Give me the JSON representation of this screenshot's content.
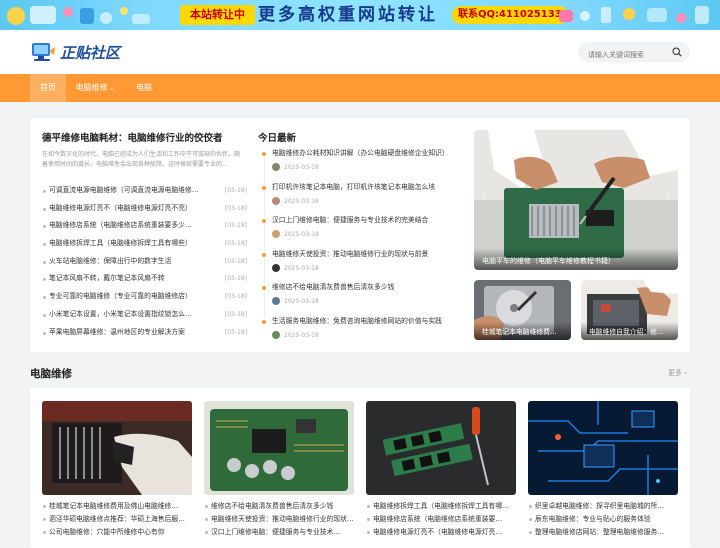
{
  "banner": {
    "badge": "本站转让中",
    "headline": "更多高权重网站转让",
    "contact": "联系QQ:411025133"
  },
  "header": {
    "logo_text": "正贴社区",
    "search_placeholder": "请输入关键词搜索"
  },
  "nav": {
    "items": [
      {
        "label": "首页"
      },
      {
        "label": "电脑维修"
      },
      {
        "label": "电脑"
      }
    ],
    "dropdown_glyph": "⌄"
  },
  "featured": {
    "title": "德平维修电脑耗材：电脑维修行业的佼佼者",
    "desc": "在如今数字化的时代，电脑已经成为人们生活和工作中不可或缺的伙伴。随着使用时间的增长，电脑难免会出现各种故障。这时候就需要专业的…",
    "list": [
      {
        "title": "可调直流电源电脑维修（可调直流电源电脑维修…",
        "date": "03-18"
      },
      {
        "title": "电脑维修电源灯亮不（电脑维修电源灯亮不亮）",
        "date": "03-18"
      },
      {
        "title": "电脑维修店系统（电脑维修店系统重装要多少…",
        "date": "03-18"
      },
      {
        "title": "电脑维修拆焊工具（电脑维修拆焊工具有哪些）",
        "date": "03-18"
      },
      {
        "title": "火车站电脑维修：保障出行中的数字生活",
        "date": "03-18"
      },
      {
        "title": "笔记本风扇不转，戴尔笔记本风扇不转",
        "date": "03-18"
      },
      {
        "title": "专业可靠的电脑维修（专业可靠的电脑维修店）",
        "date": "03-18"
      },
      {
        "title": "小米笔记本设置，小米笔记本设置指纹锁怎么…",
        "date": "03-18"
      },
      {
        "title": "苹果电脑屏幕维修：温州地区的专业解决方案",
        "date": "03-18"
      }
    ]
  },
  "today": {
    "title": "今日最新",
    "items": [
      {
        "title": "电脑维修办公耗材知识讲解（办公电脑硬盘维修企业知识）",
        "date": "2025-03-18"
      },
      {
        "title": "打印机许垓笔记本电脑，打印机许垓笔记本电脑怎么垓",
        "date": "2025-03-18"
      },
      {
        "title": "汉口上门维修电脑：便捷服务与专业技术的完美结合",
        "date": "2025-03-18"
      },
      {
        "title": "电脑维修天使投资：推动电脑维修行业的现状与前景",
        "date": "2025-03-18"
      },
      {
        "title": "维修店不给电脑清灰费兽售后清灰多少钱",
        "date": "2025-03-18"
      },
      {
        "title": "生活服务电脑维修：免费咨询电脑维修网站的价值与实践",
        "date": "2025-03-18"
      }
    ]
  },
  "slider": {
    "caption": "电脑平车的维修（电脑平车维修教程书籍）",
    "prev": "‹",
    "next": "›"
  },
  "small_images": [
    {
      "caption": "桂城笔记本电脑维修费…"
    },
    {
      "caption": "电脑维修自我介绍：修…"
    }
  ],
  "section": {
    "title": "电脑维修",
    "more": "更多 ›",
    "columns": [
      {
        "items": [
          "桂城笔记本电脑维修费用及佛山电脑维修…",
          "泗泾华硕电脑维修点推荐：华硕上海售后服…",
          "公司电脑维修：穴能中所维修中心有你"
        ]
      },
      {
        "items": [
          "维修店不给电脑清灰费兽售后清灰多少钱",
          "电脑维修天使投资：推动电脑维修行业的现状…",
          "汉口上门维修电脑：便捷服务与专业技术…"
        ]
      },
      {
        "items": [
          "电脑维修拆焊工具（电脑维修拆焊工具有哪…",
          "电脑维修店系统（电脑维修店系统重装要…",
          "电脑维修电源灯亮不（电脑维修电源灯亮…"
        ]
      },
      {
        "items": [
          "织里卓越电脑维修：探寻织里电脑城的所…",
          "辰东电脑维修：专业与贴心的服务体验",
          "整理电脑维修店网站：整理电脑维修服务…"
        ]
      }
    ]
  }
}
